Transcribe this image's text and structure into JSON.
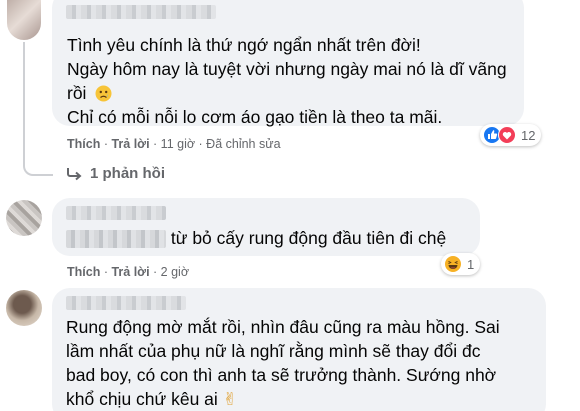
{
  "comments": [
    {
      "text_lines": [
        "Tình yêu chính là thứ ngớ ngẩn nhất trên đời!",
        "Ngày hôm nay là tuyệt vời nhưng ngày mai nó là dĩ vãng",
        "rồi"
      ],
      "text_line_last": "Chỉ có mỗi nỗi lo cơm áo gạo tiền là theo ta mãi.",
      "like_label": "Thích",
      "reply_label": "Trả lời",
      "time": "11 giờ",
      "edited": "Đã chỉnh sửa",
      "reaction_count": "12",
      "reaction_icons": [
        "like-icon",
        "love-icon"
      ],
      "replies_label": "1 phản hồi"
    },
    {
      "text": "từ bỏ cấy rung động đầu tiên đi chệ",
      "like_label": "Thích",
      "reply_label": "Trả lời",
      "time": "2 giờ",
      "reaction_count": "1",
      "reaction_icons": [
        "haha-icon"
      ]
    },
    {
      "text_lines": [
        "Rung động mờ mắt rồi, nhìn đâu cũng ra màu hồng. Sai",
        "lầm nhất của phụ nữ là nghĩ rằng mình sẽ thay đổi đc",
        "bad boy, có con thì anh ta sẽ trưởng thành. Sướng nhờ",
        "khổ chịu chứ kêu ai"
      ],
      "emoji": "✌"
    }
  ],
  "colors": {
    "bubble": "#f0f2f5",
    "meta_text": "#65676b",
    "like_blue": "#1877f2",
    "love_red": "#f33e58",
    "haha_yellow": "#f7b125"
  }
}
